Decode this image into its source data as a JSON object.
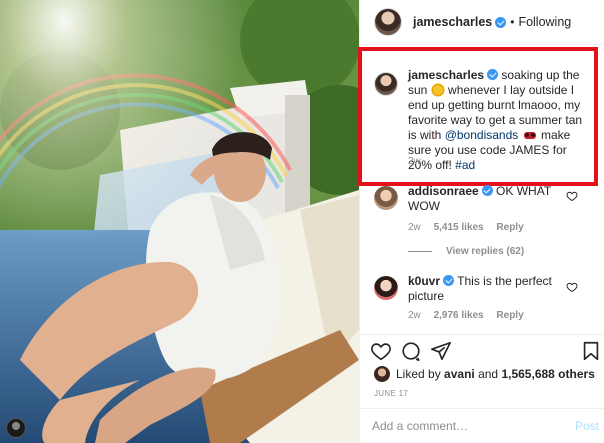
{
  "post": {
    "username": "jamescharles",
    "follow_state": "Following",
    "caption": {
      "username": "jamescharles",
      "text_1": "soaking up the sun",
      "text_2": "whenever I lay outside I end up getting burnt lmaooo, my favorite way to get a summer tan is with",
      "mention": "@bondisands",
      "text_3": "make sure you use code JAMES for 20% off!",
      "hashtag": "#ad",
      "time": "2w"
    },
    "comments": [
      {
        "username": "addisonraee",
        "text": "OK WHAT WOW",
        "time": "2w",
        "likes": "5,415 likes",
        "reply": "Reply",
        "view_replies": "View replies (62)"
      },
      {
        "username": "k0uvr",
        "text": "This is the perfect picture",
        "time": "2w",
        "likes": "2,976 likes",
        "reply": "Reply"
      }
    ],
    "likes": {
      "prefix": "Liked by",
      "user": "avani",
      "middle": "and",
      "count": "1,565,688 others"
    },
    "date": "JUNE 17",
    "add_comment_placeholder": "Add a comment…",
    "post_label": "Post"
  },
  "icons": {
    "heart": "heart-icon",
    "comment": "comment-icon",
    "share": "share-icon",
    "save": "bookmark-icon",
    "verified": "verified-badge-icon"
  },
  "colors": {
    "verified": "#3897f0",
    "highlight": "#e3121a",
    "link": "#00376b",
    "muted": "#8e8e8e",
    "post_disabled": "#b2dffc"
  }
}
